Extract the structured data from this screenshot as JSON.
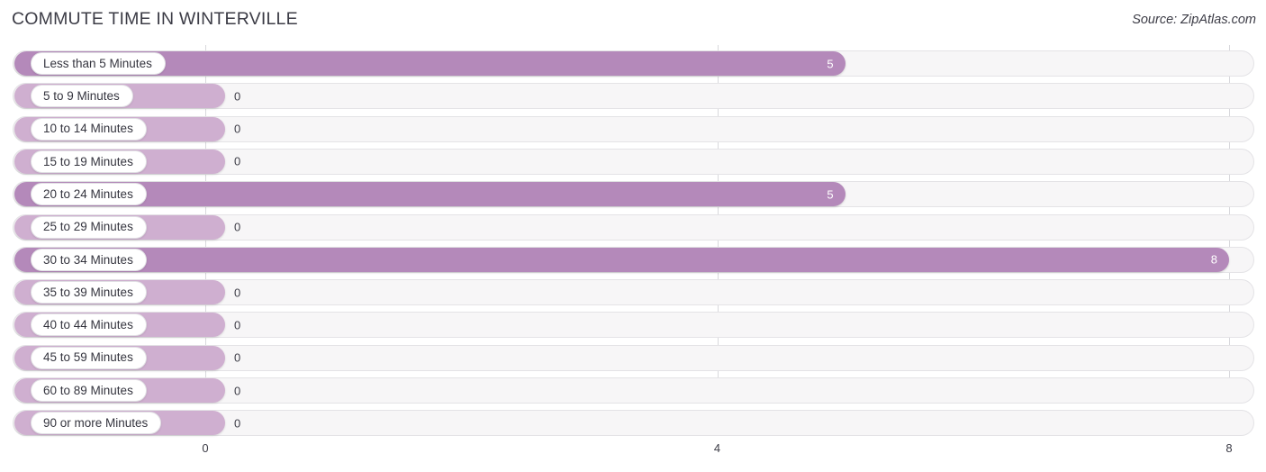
{
  "header": {
    "title": "COMMUTE TIME IN WINTERVILLE",
    "source": "Source: ZipAtlas.com"
  },
  "colors": {
    "bar_filled": "#b489ba",
    "bar_empty": "#cfafd0",
    "track": "#f7f6f7",
    "gridline": "#d8d8dc",
    "text": "#3c3c46"
  },
  "chart_data": {
    "type": "bar",
    "orientation": "horizontal",
    "title": "COMMUTE TIME IN WINTERVILLE",
    "xlabel": "",
    "ylabel": "",
    "xlim": [
      0,
      8
    ],
    "grid": true,
    "legend": "none",
    "xticks": [
      "0",
      "4",
      "8"
    ],
    "xtick_values": [
      0,
      4,
      8
    ],
    "categories": [
      "Less than 5 Minutes",
      "5 to 9 Minutes",
      "10 to 14 Minutes",
      "15 to 19 Minutes",
      "20 to 24 Minutes",
      "25 to 29 Minutes",
      "30 to 34 Minutes",
      "35 to 39 Minutes",
      "40 to 44 Minutes",
      "45 to 59 Minutes",
      "60 to 89 Minutes",
      "90 or more Minutes"
    ],
    "values": [
      5,
      0,
      0,
      0,
      5,
      0,
      8,
      0,
      0,
      0,
      0,
      0
    ],
    "value_labels": [
      "5",
      "0",
      "0",
      "0",
      "5",
      "0",
      "8",
      "0",
      "0",
      "0",
      "0",
      "0"
    ]
  },
  "rows": [
    {
      "label": "Less than 5 Minutes",
      "value": 5,
      "value_label": "5",
      "inside": true
    },
    {
      "label": "5 to 9 Minutes",
      "value": 0,
      "value_label": "0",
      "inside": false
    },
    {
      "label": "10 to 14 Minutes",
      "value": 0,
      "value_label": "0",
      "inside": false
    },
    {
      "label": "15 to 19 Minutes",
      "value": 0,
      "value_label": "0",
      "inside": false
    },
    {
      "label": "20 to 24 Minutes",
      "value": 5,
      "value_label": "5",
      "inside": true
    },
    {
      "label": "25 to 29 Minutes",
      "value": 0,
      "value_label": "0",
      "inside": false
    },
    {
      "label": "30 to 34 Minutes",
      "value": 8,
      "value_label": "8",
      "inside": true
    },
    {
      "label": "35 to 39 Minutes",
      "value": 0,
      "value_label": "0",
      "inside": false
    },
    {
      "label": "40 to 44 Minutes",
      "value": 0,
      "value_label": "0",
      "inside": false
    },
    {
      "label": "45 to 59 Minutes",
      "value": 0,
      "value_label": "0",
      "inside": false
    },
    {
      "label": "60 to 89 Minutes",
      "value": 0,
      "value_label": "0",
      "inside": false
    },
    {
      "label": "90 or more Minutes",
      "value": 0,
      "value_label": "0",
      "inside": false
    }
  ],
  "axis": {
    "ticks": [
      {
        "label": "0",
        "value": 0
      },
      {
        "label": "4",
        "value": 4
      },
      {
        "label": "8",
        "value": 8
      }
    ]
  }
}
